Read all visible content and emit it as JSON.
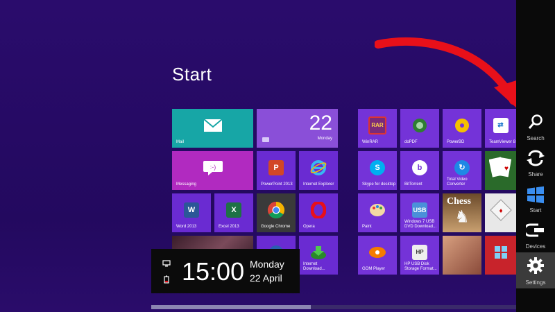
{
  "start": {
    "title": "Start"
  },
  "tiles": {
    "mail": "Mail",
    "calendar": {
      "date": "22",
      "day": "Monday"
    },
    "messaging": "Messaging",
    "powerpoint": "PowerPoint 2013",
    "ie": "Internet Explorer",
    "word": "Word 2013",
    "excel": "Excel 2013",
    "chrome": "Google Chrome",
    "opera": "Opera",
    "idm": "Internet Download...",
    "winrar": "WinRAR",
    "dopdf": "doPDF",
    "powerbd": "PowerBD",
    "teamviewer": "TeamViewer 8",
    "skype": "Skype for desktop",
    "bittorrent": "BitTorrent",
    "totalvideo": "Total Video Converter",
    "paint": "Paint",
    "win7usb": "Windows 7 USB DVD Download...",
    "chess_title": "Chess",
    "gom": "GOM Player",
    "hpusb": "HP USB Disk Storage Format..."
  },
  "clock": {
    "time": "15:00",
    "day": "Monday",
    "date": "22 April"
  },
  "charms": {
    "search": "Search",
    "share": "Share",
    "start": "Start",
    "devices": "Devices",
    "settings": "Settings"
  },
  "colors": {
    "background": "#2a0c6c",
    "tile": "#6a2bd2",
    "accent_red": "#e8101a"
  }
}
